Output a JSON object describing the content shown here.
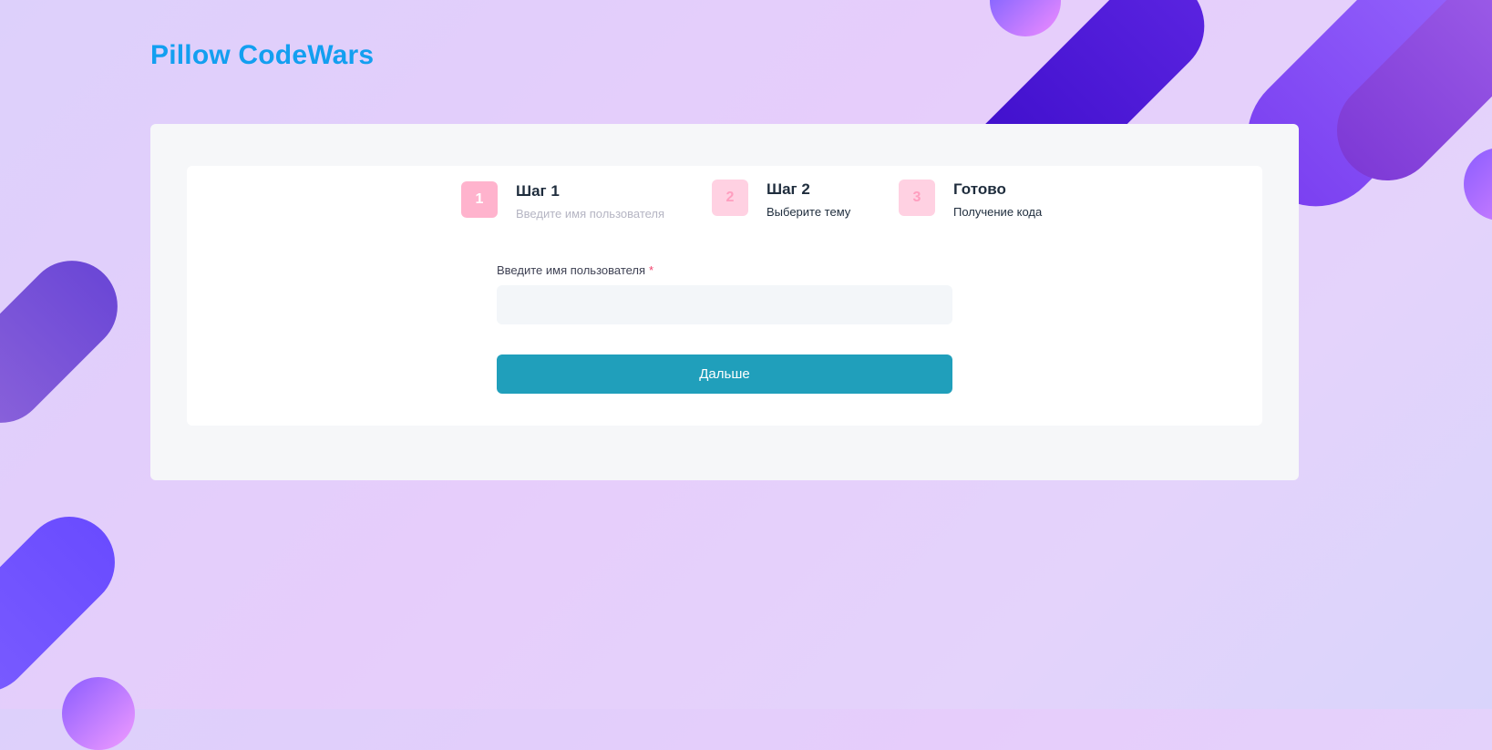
{
  "brand": {
    "logo_text": "Pillow CodeWars"
  },
  "stepper": {
    "steps": [
      {
        "number": "1",
        "title": "Шаг 1",
        "description": "Введите имя пользователя",
        "state": "active"
      },
      {
        "number": "2",
        "title": "Шаг 2",
        "description": "Выберите тему",
        "state": "pending"
      },
      {
        "number": "3",
        "title": "Готово",
        "description": "Получение кода",
        "state": "pending"
      }
    ]
  },
  "form": {
    "username_label": "Введите имя пользователя",
    "required_marker": "*",
    "username_value": "",
    "next_button_label": "Дальше"
  },
  "colors": {
    "brand": "#139ff0",
    "primary_button": "#209fbb",
    "step_active": "#ffb3cd",
    "step_pending": "#ffd1e2",
    "required": "#f1416c"
  }
}
